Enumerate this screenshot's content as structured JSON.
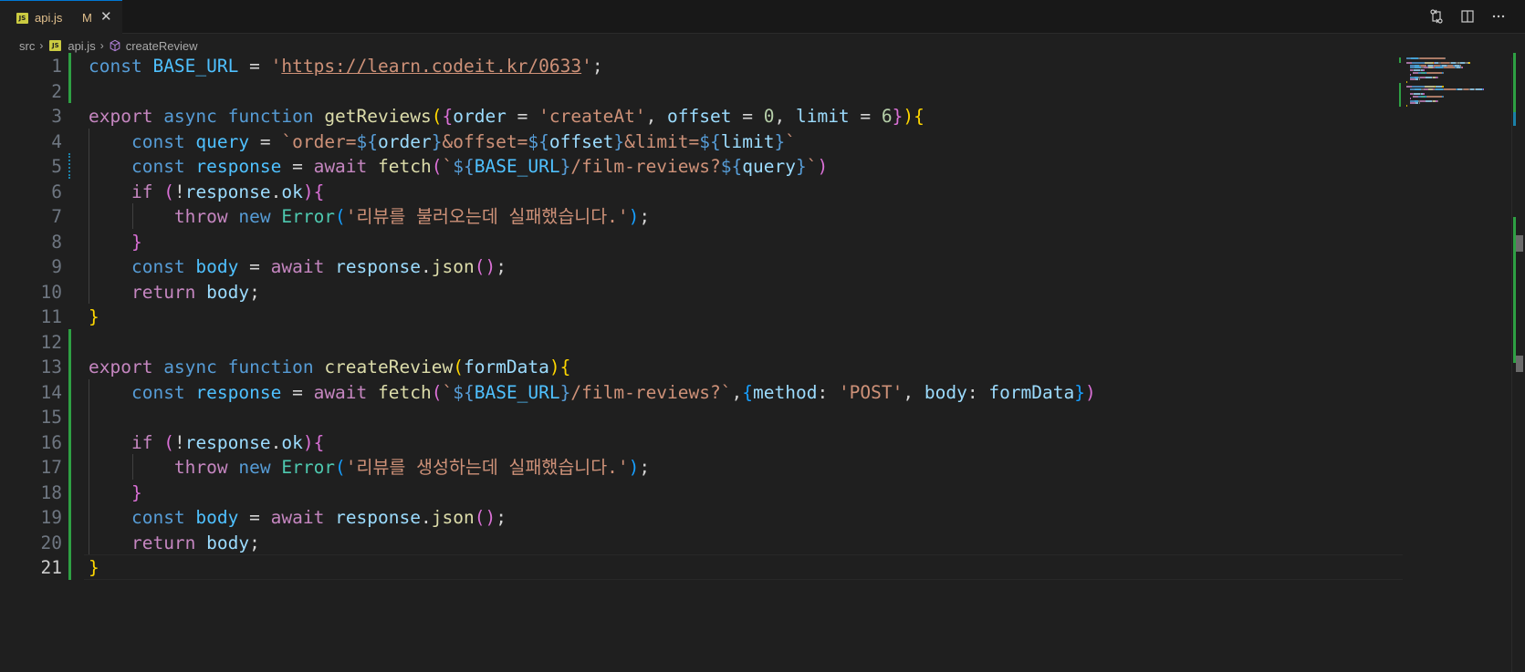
{
  "tab": {
    "filename": "api.js",
    "status": "M",
    "file_icon": "JS",
    "close_icon": "close-icon"
  },
  "toolbar": {
    "icons": [
      "compare-changes-icon",
      "split-editor-icon",
      "more-actions-icon"
    ]
  },
  "breadcrumb": {
    "folder": "src",
    "file": "api.js",
    "symbol": "createReview"
  },
  "editor": {
    "active_line": 21,
    "lines": [
      [
        [
          "kw",
          "const "
        ],
        [
          "const",
          "BASE_URL"
        ],
        [
          "op",
          " = "
        ],
        [
          "str",
          "'"
        ],
        [
          "str url",
          "https://learn.codeit.kr/0633"
        ],
        [
          "str",
          "'"
        ],
        [
          "op",
          ";"
        ]
      ],
      [],
      [
        [
          "kw2",
          "export "
        ],
        [
          "kw",
          "async "
        ],
        [
          "kw",
          "function "
        ],
        [
          "fn",
          "getReviews"
        ],
        [
          "p1",
          "("
        ],
        [
          "p2",
          "{"
        ],
        [
          "var",
          "order"
        ],
        [
          "op",
          " = "
        ],
        [
          "str",
          "'createAt'"
        ],
        [
          "op",
          ", "
        ],
        [
          "var",
          "offset"
        ],
        [
          "op",
          " = "
        ],
        [
          "num",
          "0"
        ],
        [
          "op",
          ", "
        ],
        [
          "var",
          "limit"
        ],
        [
          "op",
          " = "
        ],
        [
          "num",
          "6"
        ],
        [
          "p2",
          "}"
        ],
        [
          "p1",
          ")"
        ],
        [
          "p1",
          "{"
        ]
      ],
      [
        [
          "op",
          "    "
        ],
        [
          "kw",
          "const "
        ],
        [
          "const",
          "query"
        ],
        [
          "op",
          " = "
        ],
        [
          "str",
          "`order="
        ],
        [
          "kw",
          "${"
        ],
        [
          "var",
          "order"
        ],
        [
          "kw",
          "}"
        ],
        [
          "str",
          "&offset="
        ],
        [
          "kw",
          "${"
        ],
        [
          "var",
          "offset"
        ],
        [
          "kw",
          "}"
        ],
        [
          "str",
          "&limit="
        ],
        [
          "kw",
          "${"
        ],
        [
          "var",
          "limit"
        ],
        [
          "kw",
          "}"
        ],
        [
          "str",
          "`"
        ]
      ],
      [
        [
          "op",
          "    "
        ],
        [
          "kw",
          "const "
        ],
        [
          "const",
          "response"
        ],
        [
          "op",
          " = "
        ],
        [
          "kw2",
          "await "
        ],
        [
          "fn",
          "fetch"
        ],
        [
          "p2",
          "("
        ],
        [
          "str",
          "`"
        ],
        [
          "kw",
          "${"
        ],
        [
          "const",
          "BASE_URL"
        ],
        [
          "kw",
          "}"
        ],
        [
          "str",
          "/film-reviews?"
        ],
        [
          "kw",
          "${"
        ],
        [
          "var",
          "query"
        ],
        [
          "kw",
          "}"
        ],
        [
          "str",
          "`"
        ],
        [
          "p2",
          ")"
        ]
      ],
      [
        [
          "op",
          "    "
        ],
        [
          "kw2",
          "if "
        ],
        [
          "p2",
          "("
        ],
        [
          "op",
          "!"
        ],
        [
          "var",
          "response"
        ],
        [
          "op",
          "."
        ],
        [
          "var",
          "ok"
        ],
        [
          "p2",
          ")"
        ],
        [
          "p2",
          "{"
        ]
      ],
      [
        [
          "op",
          "        "
        ],
        [
          "kw2",
          "throw "
        ],
        [
          "kw",
          "new "
        ],
        [
          "cls",
          "Error"
        ],
        [
          "p3",
          "("
        ],
        [
          "str",
          "'리뷰를 불러오는데 실패했습니다.'"
        ],
        [
          "p3",
          ")"
        ],
        [
          "op",
          ";"
        ]
      ],
      [
        [
          "op",
          "    "
        ],
        [
          "p2",
          "}"
        ]
      ],
      [
        [
          "op",
          "    "
        ],
        [
          "kw",
          "const "
        ],
        [
          "const",
          "body"
        ],
        [
          "op",
          " = "
        ],
        [
          "kw2",
          "await "
        ],
        [
          "var",
          "response"
        ],
        [
          "op",
          "."
        ],
        [
          "fn",
          "json"
        ],
        [
          "p2",
          "()"
        ],
        [
          "op",
          ";"
        ]
      ],
      [
        [
          "op",
          "    "
        ],
        [
          "kw2",
          "return "
        ],
        [
          "var",
          "body"
        ],
        [
          "op",
          ";"
        ]
      ],
      [
        [
          "p1",
          "}"
        ]
      ],
      [],
      [
        [
          "kw2",
          "export "
        ],
        [
          "kw",
          "async "
        ],
        [
          "kw",
          "function "
        ],
        [
          "fn",
          "createReview"
        ],
        [
          "p1",
          "("
        ],
        [
          "var",
          "formData"
        ],
        [
          "p1",
          ")"
        ],
        [
          "p1",
          "{"
        ]
      ],
      [
        [
          "op",
          "    "
        ],
        [
          "kw",
          "const "
        ],
        [
          "const",
          "response"
        ],
        [
          "op",
          " = "
        ],
        [
          "kw2",
          "await "
        ],
        [
          "fn",
          "fetch"
        ],
        [
          "p2",
          "("
        ],
        [
          "str",
          "`"
        ],
        [
          "kw",
          "${"
        ],
        [
          "const",
          "BASE_URL"
        ],
        [
          "kw",
          "}"
        ],
        [
          "str",
          "/film-reviews?`"
        ],
        [
          "op",
          ","
        ],
        [
          "p3",
          "{"
        ],
        [
          "var",
          "method"
        ],
        [
          "op",
          ": "
        ],
        [
          "str",
          "'POST'"
        ],
        [
          "op",
          ", "
        ],
        [
          "var",
          "body"
        ],
        [
          "op",
          ": "
        ],
        [
          "var",
          "formData"
        ],
        [
          "p3",
          "}"
        ],
        [
          "p2",
          ")"
        ]
      ],
      [],
      [
        [
          "op",
          "    "
        ],
        [
          "kw2",
          "if "
        ],
        [
          "p2",
          "("
        ],
        [
          "op",
          "!"
        ],
        [
          "var",
          "response"
        ],
        [
          "op",
          "."
        ],
        [
          "var",
          "ok"
        ],
        [
          "p2",
          ")"
        ],
        [
          "p2",
          "{"
        ]
      ],
      [
        [
          "op",
          "        "
        ],
        [
          "kw2",
          "throw "
        ],
        [
          "kw",
          "new "
        ],
        [
          "cls",
          "Error"
        ],
        [
          "p3",
          "("
        ],
        [
          "str",
          "'리뷰를 생성하는데 실패했습니다.'"
        ],
        [
          "p3",
          ")"
        ],
        [
          "op",
          ";"
        ]
      ],
      [
        [
          "op",
          "    "
        ],
        [
          "p2",
          "}"
        ]
      ],
      [
        [
          "op",
          "    "
        ],
        [
          "kw",
          "const "
        ],
        [
          "const",
          "body"
        ],
        [
          "op",
          " = "
        ],
        [
          "kw2",
          "await "
        ],
        [
          "var",
          "response"
        ],
        [
          "op",
          "."
        ],
        [
          "fn",
          "json"
        ],
        [
          "p2",
          "()"
        ],
        [
          "op",
          ";"
        ]
      ],
      [
        [
          "op",
          "    "
        ],
        [
          "kw2",
          "return "
        ],
        [
          "var",
          "body"
        ],
        [
          "op",
          ";"
        ]
      ],
      [
        [
          "p1",
          "}"
        ]
      ]
    ]
  }
}
